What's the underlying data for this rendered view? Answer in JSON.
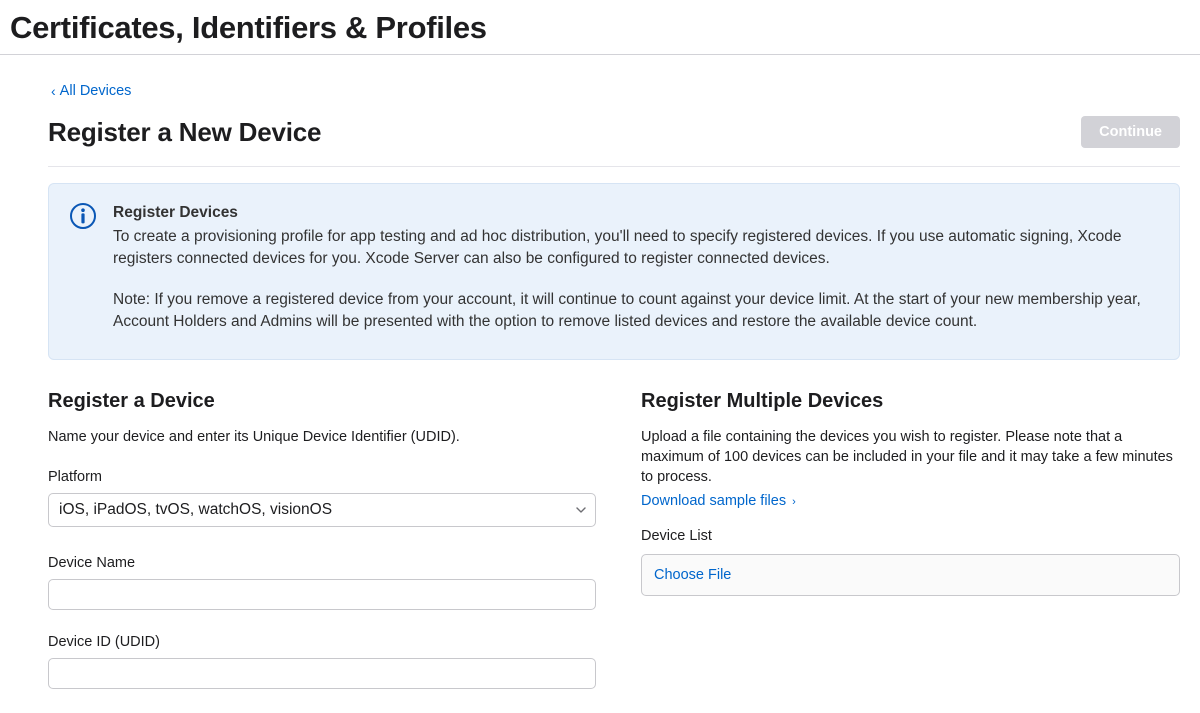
{
  "header": {
    "title": "Certificates, Identifiers & Profiles"
  },
  "nav": {
    "back_label": "All Devices"
  },
  "page": {
    "title": "Register a New Device",
    "continue_label": "Continue"
  },
  "info": {
    "title": "Register Devices",
    "para1": "To create a provisioning profile for app testing and ad hoc distribution, you'll need to specify registered devices. If you use automatic signing, Xcode registers connected devices for you. Xcode Server can also be configured to register connected devices.",
    "para2": "Note: If you remove a registered device from your account, it will continue to count against your device limit. At the start of your new membership year, Account Holders and Admins will be presented with the option to remove listed devices and restore the available device count."
  },
  "single": {
    "title": "Register a Device",
    "desc": "Name your device and enter its Unique Device Identifier (UDID).",
    "platform_label": "Platform",
    "platform_value": "iOS, iPadOS, tvOS, watchOS, visionOS",
    "name_label": "Device Name",
    "udid_label": "Device ID (UDID)"
  },
  "multi": {
    "title": "Register Multiple Devices",
    "desc": "Upload a file containing the devices you wish to register. Please note that a maximum of 100 devices can be included in your file and it may take a few minutes to process.",
    "sample_link": "Download sample files",
    "list_label": "Device List",
    "choose_file": "Choose File"
  }
}
